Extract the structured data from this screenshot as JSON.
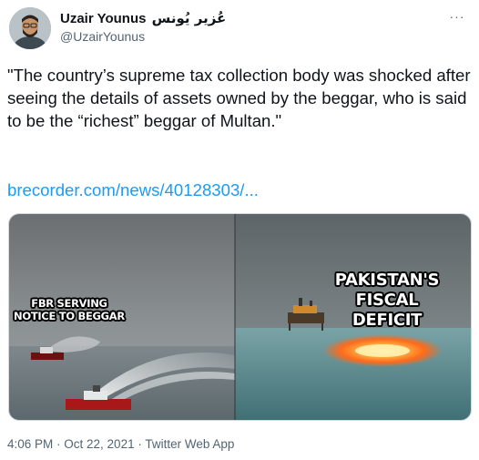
{
  "author": {
    "display_name": "Uzair Younus",
    "display_name_urdu": "عُزیر یُونس",
    "handle": "@UzairYounus"
  },
  "more_label": "···",
  "tweet": {
    "text": "\"The country’s supreme tax collection body was shocked after seeing the details of assets owned by the beggar, who is said to be the “richest” beggar of Multan.\"",
    "link_text": "brecorder.com/news/40128303/..."
  },
  "media": {
    "label_left": "FBR SERVING NOTICE TO BEGGAR",
    "label_right": "PAKISTAN'S FISCAL DEFICIT"
  },
  "meta": {
    "time": "4:06 PM",
    "separator": " · ",
    "date": "Oct 22, 2021",
    "source": "Twitter Web App"
  },
  "colors": {
    "link": "#1d9bf0",
    "secondary_text": "#536471",
    "primary_text": "#0f1419"
  }
}
